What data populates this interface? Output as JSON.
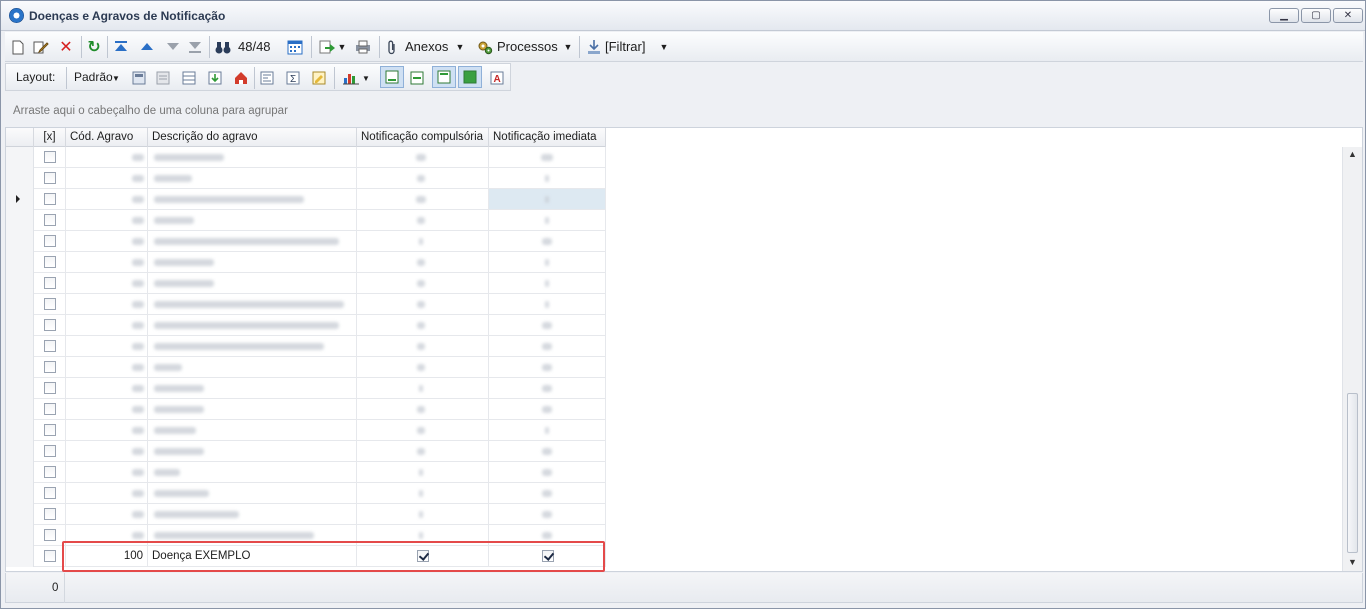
{
  "window": {
    "title": "Doenças e Agravos de Notificação",
    "controls": {
      "minimize": "▁",
      "maximize": "▢",
      "close": "✕"
    }
  },
  "toolbar": {
    "record_counter": "48/48",
    "attachments_label": "Anexos",
    "processes_label": "Processos",
    "filter_label": "[Filtrar]"
  },
  "layout_bar": {
    "layout_label": "Layout:",
    "preset_label": "Padrão"
  },
  "group_panel": {
    "hint": "Arraste aqui o cabeçalho de uma coluna para agrupar"
  },
  "grid": {
    "columns": {
      "select": "[x]",
      "code": "Cód. Agravo",
      "description": "Descrição do agravo",
      "compulsory": "Notificação compulsória",
      "immediate": "Notificação imediata"
    },
    "highlighted_row": {
      "code": "100",
      "description": "Doença EXEMPLO",
      "compulsory": true,
      "immediate": true
    }
  },
  "footer": {
    "count": "0"
  },
  "colors": {
    "highlight": "#e44a4a",
    "selected_row": "#dde9f2"
  }
}
